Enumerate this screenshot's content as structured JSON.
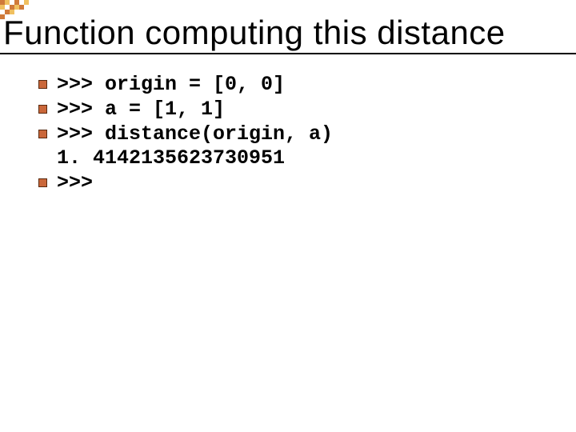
{
  "title": "Function computing this distance",
  "lines": [
    {
      "bullet": true,
      "text": ">>> origin = [0, 0]"
    },
    {
      "bullet": true,
      "text": ">>> a = [1, 1]"
    },
    {
      "bullet": true,
      "text": ">>> distance(origin, a)"
    },
    {
      "bullet": false,
      "text": "1. 4142135623730951"
    },
    {
      "bullet": true,
      "text": ">>>"
    }
  ]
}
